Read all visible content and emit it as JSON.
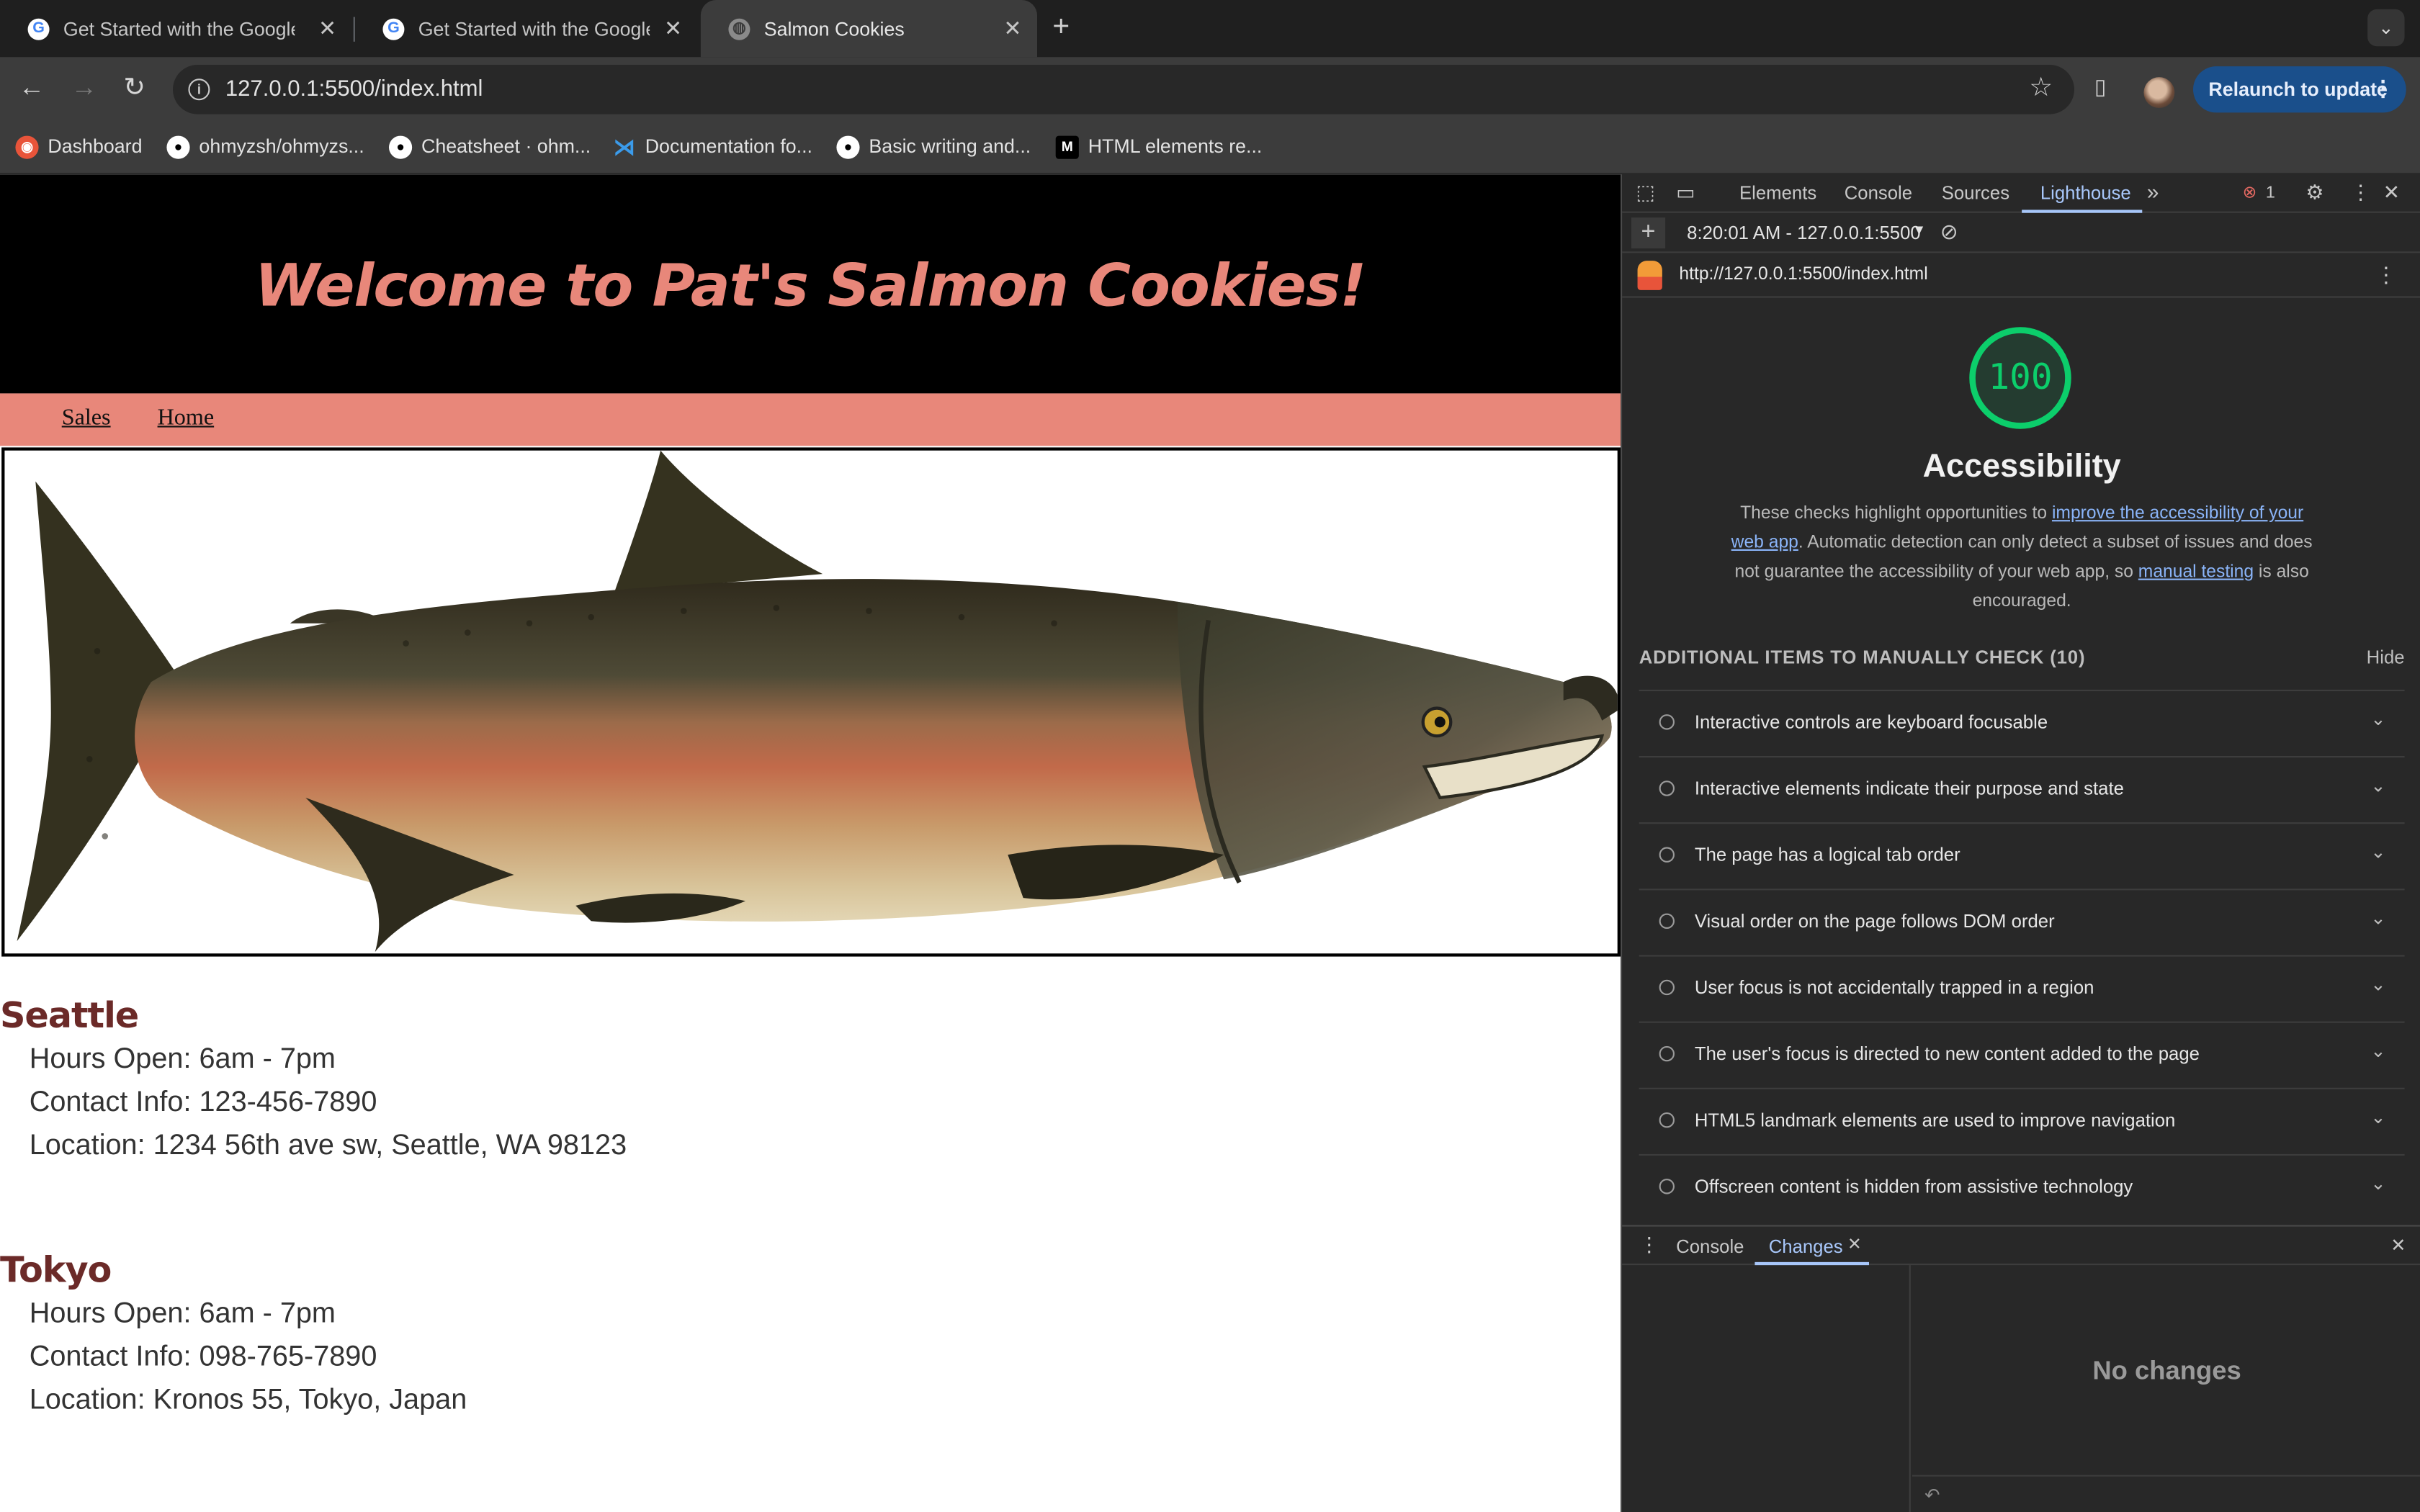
{
  "browser": {
    "tabs": [
      {
        "title": "Get Started with the Google",
        "favicon": "google-icon"
      },
      {
        "title": "Get Started with the Google",
        "favicon": "google-icon"
      },
      {
        "title": "Salmon Cookies",
        "favicon": "globe-icon"
      }
    ],
    "new_tab": "+",
    "address": "127.0.0.1:5500/index.html",
    "relaunch_label": "Relaunch to update",
    "bookmarks": [
      {
        "label": "Dashboard",
        "icon": "dashboard-icon",
        "color": "#e8543a"
      },
      {
        "label": "ohmyzsh/ohmyzs...",
        "icon": "github-icon",
        "color": "#ffffff"
      },
      {
        "label": "Cheatsheet · ohm...",
        "icon": "github-icon",
        "color": "#ffffff"
      },
      {
        "label": "Documentation fo...",
        "icon": "vscode-icon",
        "color": "#3b9bea"
      },
      {
        "label": "Basic writing and...",
        "icon": "github-icon",
        "color": "#ffffff"
      },
      {
        "label": "HTML elements re...",
        "icon": "mdn-icon",
        "color": "#ffffff"
      }
    ]
  },
  "site": {
    "heading": "Welcome to Pat's Salmon Cookies!",
    "nav": [
      "Sales",
      "Home"
    ],
    "image_subject": "salmon",
    "cities": [
      {
        "name": "Seattle",
        "hours": "Hours Open: 6am - 7pm",
        "contact": "Contact Info: 123-456-7890",
        "location": "Location: 1234 56th ave sw, Seattle, WA 98123"
      },
      {
        "name": "Tokyo",
        "hours": "Hours Open: 6am - 7pm",
        "contact": "Contact Info: 098-765-7890",
        "location": "Location: Kronos 55, Tokyo, Japan"
      }
    ]
  },
  "devtools": {
    "tabs": [
      "Elements",
      "Console",
      "Sources",
      "Lighthouse"
    ],
    "active_tab": "Lighthouse",
    "error_count": "1",
    "report_time": "8:20:01 AM - 127.0.0.1:5500",
    "report_url": "http://127.0.0.1:5500/index.html",
    "score": "100",
    "score_color": "#0cce6b",
    "category_title": "Accessibility",
    "desc_part1": "These checks highlight opportunities to ",
    "desc_link1": "improve the accessibility of your web app",
    "desc_part2": ". Automatic detection can only detect a subset of issues and does not guarantee the accessibility of your web app, so ",
    "desc_link2": "manual testing",
    "desc_part3": " is also encouraged.",
    "manual_header": "ADDITIONAL ITEMS TO MANUALLY CHECK (10)",
    "hide_label": "Hide",
    "audits": [
      "Interactive controls are keyboard focusable",
      "Interactive elements indicate their purpose and state",
      "The page has a logical tab order",
      "Visual order on the page follows DOM order",
      "User focus is not accidentally trapped in a region",
      "The user's focus is directed to new content added to the page",
      "HTML5 landmark elements are used to improve navigation",
      "Offscreen content is hidden from assistive technology"
    ],
    "drawer": {
      "tabs": [
        "Console",
        "Changes"
      ],
      "active_tab": "Changes",
      "empty_text": "No changes"
    }
  }
}
